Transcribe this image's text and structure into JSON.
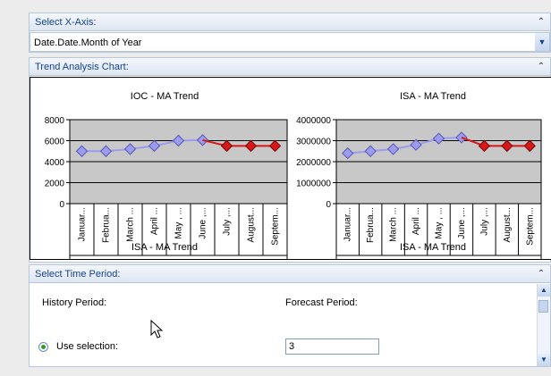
{
  "xaxis_panel": {
    "title": "Select X-Axis:",
    "selected_value": "Date.Date.Month of Year"
  },
  "trend_panel": {
    "title": "Trend Analysis Chart:"
  },
  "time_panel": {
    "title": "Select Time Period:",
    "history_label": "History Period:",
    "forecast_label": "Forecast Period:",
    "use_selection_label": "Use selection:",
    "forecast_value": "3"
  },
  "colors": {
    "history": "#9b9bf0",
    "forecast": "#d81818",
    "plot_bg": "#c8c8c8",
    "panel_header_text": "#15428b"
  },
  "icons": {
    "collapse": "double-chevron-up-icon",
    "dropdown": "chevron-down-icon"
  },
  "chart_data": [
    {
      "type": "line",
      "title": "IOC - MA Trend",
      "xlabel": "ISA - MA Trend",
      "categories": [
        "Januar...",
        "Februa...",
        "March ...",
        "April ...",
        "May , ...",
        "June ,...",
        "July ,...",
        "August...",
        "Septem..."
      ],
      "ylim": [
        0,
        8000
      ],
      "yticks": [
        "0",
        "2000",
        "4000",
        "6000",
        "8000"
      ],
      "ytick_values": [
        0,
        2000,
        4000,
        6000,
        8000
      ],
      "series": [
        {
          "role": "history",
          "values": [
            5000,
            5000,
            5200,
            5500,
            6000,
            6050,
            null,
            null,
            null
          ]
        },
        {
          "role": "forecast",
          "values": [
            null,
            null,
            null,
            null,
            null,
            6050,
            5500,
            5500,
            5500
          ]
        }
      ]
    },
    {
      "type": "line",
      "title": "ISA - MA Trend",
      "xlabel": "ISA - MA Trend",
      "categories": [
        "Januar...",
        "Februa...",
        "March ...",
        "April ...",
        "May , ...",
        "June ,...",
        "July ,...",
        "August...",
        "Septem..."
      ],
      "ylim": [
        0,
        4000000
      ],
      "yticks": [
        "0",
        "1000000",
        "2000000",
        "3000000",
        "4000000"
      ],
      "ytick_values": [
        0,
        1000000,
        2000000,
        3000000,
        4000000
      ],
      "series": [
        {
          "role": "history",
          "values": [
            2400000,
            2500000,
            2600000,
            2800000,
            3100000,
            3150000,
            null,
            null,
            null
          ]
        },
        {
          "role": "forecast",
          "values": [
            null,
            null,
            null,
            null,
            null,
            3150000,
            2750000,
            2750000,
            2750000
          ]
        }
      ]
    }
  ]
}
